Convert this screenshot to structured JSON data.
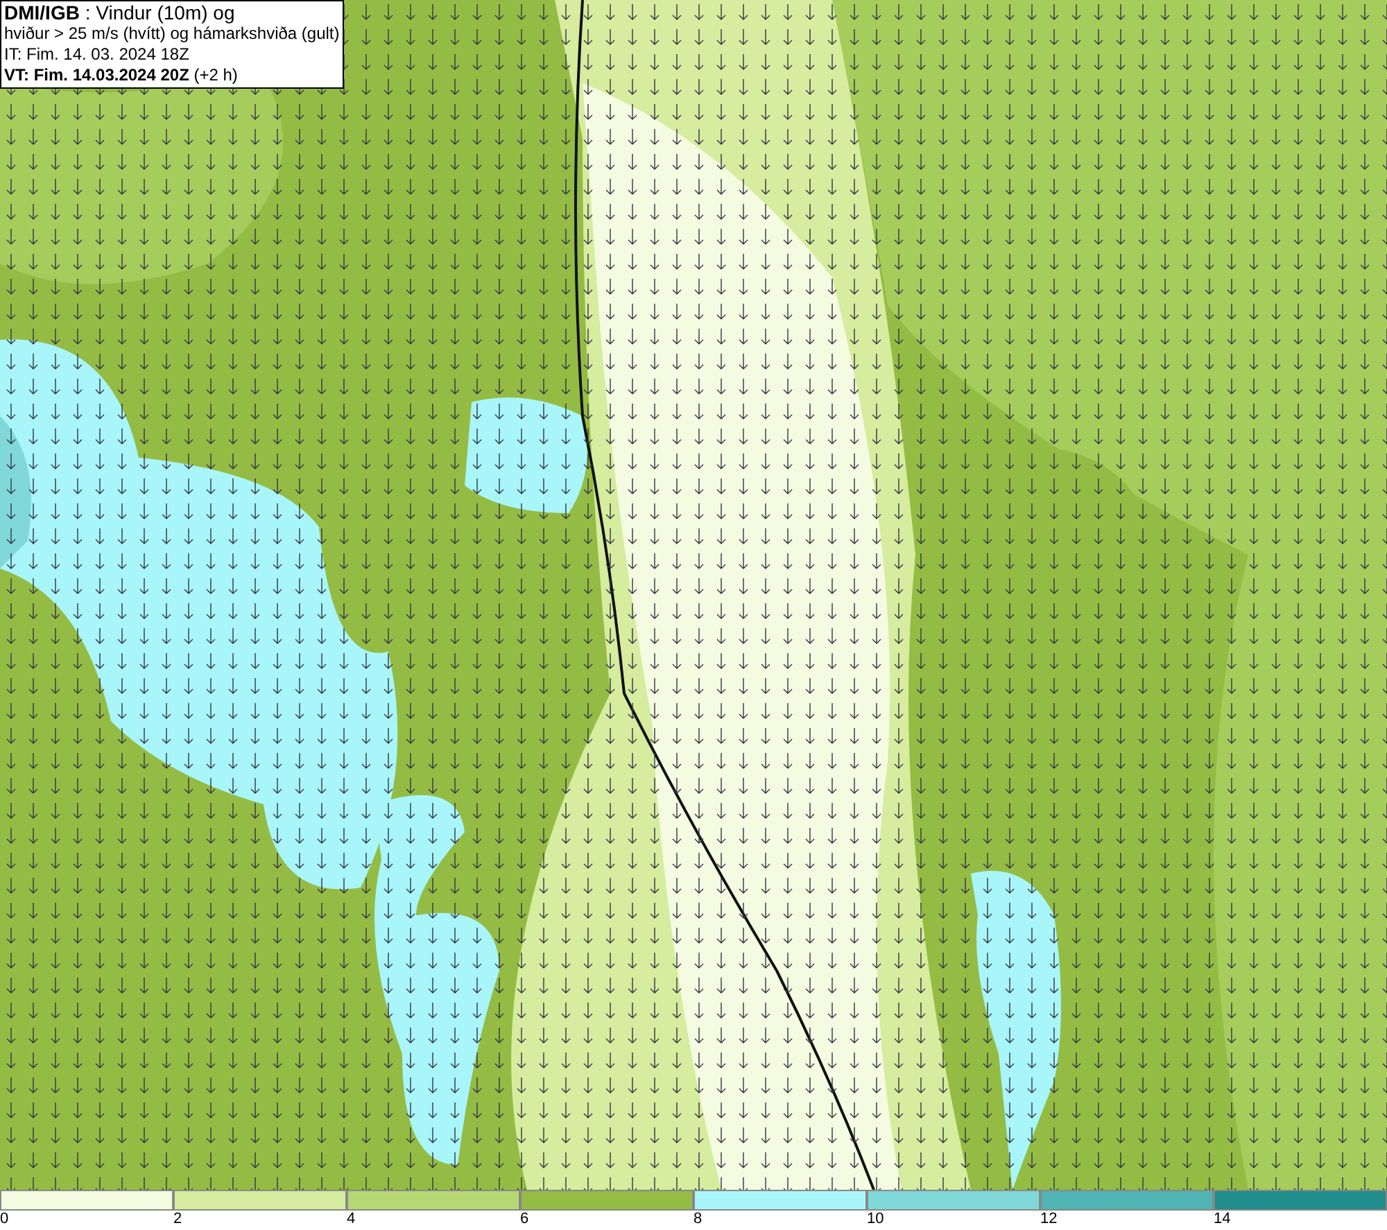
{
  "header": {
    "lines": [
      "**DMI/IGB** : Vindur (10m) og",
      "hviður > 25 m/s (hvítt) og hámarkshviða (gult)",
      "IT: Fim. 14. 03. 2024 18Z",
      "**VT: Fim. 14.03.2024 20Z** (+2 h)"
    ]
  },
  "legend": {
    "bins": [
      {
        "label": "0",
        "color": "#f4fbe0"
      },
      {
        "label": "2",
        "color": "#d6ec9e"
      },
      {
        "label": "4",
        "color": "#b6d874"
      },
      {
        "label": "6",
        "color": "#94bc44"
      },
      {
        "label": "8",
        "color": "#a8f6fa"
      },
      {
        "label": "10",
        "color": "#80d8d8"
      },
      {
        "label": "12",
        "color": "#50b4b4"
      },
      {
        "label": "14",
        "color": "#208c8c"
      }
    ]
  }
}
